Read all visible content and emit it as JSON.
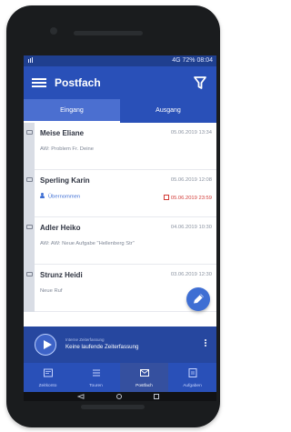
{
  "status_bar": {
    "text": "4G 72% 08:04"
  },
  "app_bar": {
    "title": "Postfach"
  },
  "tabs": [
    {
      "label": "Eingang"
    },
    {
      "label": "Ausgang"
    }
  ],
  "messages": [
    {
      "name": "Meise Eliane",
      "date": "05.06.2019 13:34",
      "subline": "AW: Problem Fr. Deine"
    },
    {
      "name": "Sperling Karin",
      "date": "05.06.2019 12:08",
      "user": "Übernommen",
      "due": "05.06.2019 23:59"
    },
    {
      "name": "Adler Heiko",
      "date": "04.06.2019 10:30",
      "subline": "AW: AW: Neue Aufgabe \"Hellenberg Str\""
    },
    {
      "name": "Strunz Heidi",
      "date": "03.06.2019 12:30",
      "subline": "Neue Ruf"
    }
  ],
  "player": {
    "small_text": "Interne Zeiterfassung",
    "main_text": "Keine laufende Zeiterfassung"
  },
  "bottom_nav": [
    {
      "label": "Zeitkonto"
    },
    {
      "label": "Touren"
    },
    {
      "label": "Postfach"
    },
    {
      "label": "Aufgaben"
    }
  ],
  "colors": {
    "primary": "#2950b8",
    "active_tab": "#4b6fd0",
    "player": "#26479f",
    "fab": "#3e6ed3",
    "alert": "#d23b37"
  },
  "icons": {
    "menu": "menu-icon",
    "filter": "filter-icon",
    "message": "message-icon",
    "user": "user-icon",
    "calendar": "calendar-icon",
    "edit": "edit-icon",
    "play": "play-icon",
    "more": "more-icon"
  }
}
